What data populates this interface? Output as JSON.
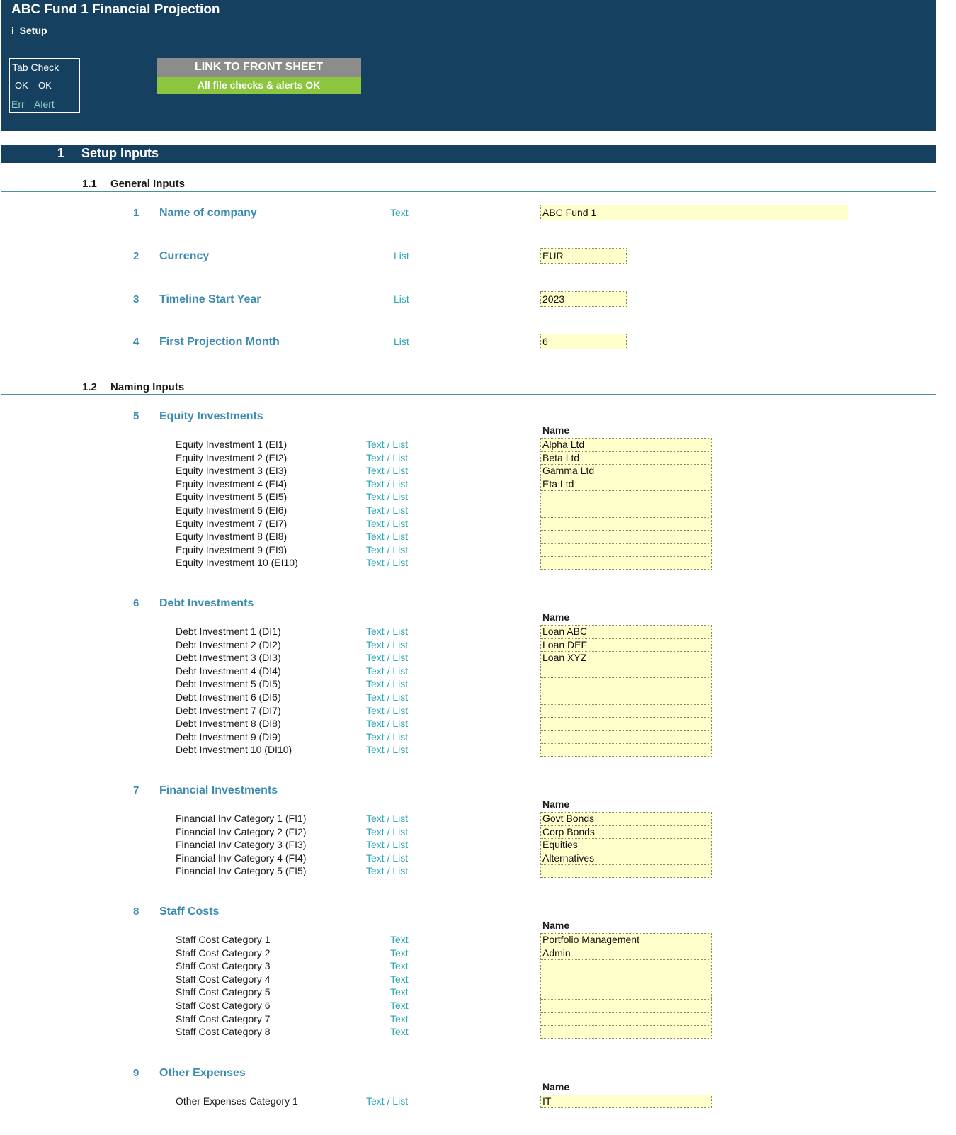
{
  "header": {
    "title": "ABC Fund 1 Financial Projection",
    "sheet_name": "i_Setup",
    "tab_check": {
      "title": "Tab Check",
      "ok_1": "OK",
      "ok_2": "OK",
      "err": "Err",
      "alert": "Alert"
    },
    "link_button": "LINK TO FRONT SHEET",
    "check_status": "All file checks & alerts OK"
  },
  "section": {
    "number": "1",
    "title": "Setup Inputs"
  },
  "general": {
    "number": "1.1",
    "title": "General Inputs",
    "items": [
      {
        "num": "1",
        "label": "Name of company",
        "type": "Text",
        "value": "ABC Fund 1"
      },
      {
        "num": "2",
        "label": "Currency",
        "type": "List",
        "value": "EUR"
      },
      {
        "num": "3",
        "label": "Timeline Start Year",
        "type": "List",
        "value": "2023"
      },
      {
        "num": "4",
        "label": "First Projection Month",
        "type": "List",
        "value": "6"
      }
    ]
  },
  "naming": {
    "number": "1.2",
    "title": "Naming Inputs",
    "name_header": "Name",
    "groups": [
      {
        "num": "5",
        "title": "Equity Investments",
        "rows": [
          {
            "label": "Equity Investment 1 (EI1)",
            "type": "Text / List",
            "value": "Alpha Ltd"
          },
          {
            "label": "Equity Investment 2 (EI2)",
            "type": "Text / List",
            "value": "Beta Ltd"
          },
          {
            "label": "Equity Investment 3 (EI3)",
            "type": "Text / List",
            "value": "Gamma Ltd"
          },
          {
            "label": "Equity Investment 4 (EI4)",
            "type": "Text / List",
            "value": "Eta Ltd"
          },
          {
            "label": "Equity Investment 5 (EI5)",
            "type": "Text / List",
            "value": ""
          },
          {
            "label": "Equity Investment 6 (EI6)",
            "type": "Text / List",
            "value": ""
          },
          {
            "label": "Equity Investment 7 (EI7)",
            "type": "Text / List",
            "value": ""
          },
          {
            "label": "Equity Investment 8 (EI8)",
            "type": "Text / List",
            "value": ""
          },
          {
            "label": "Equity Investment 9 (EI9)",
            "type": "Text / List",
            "value": ""
          },
          {
            "label": "Equity Investment 10 (EI10)",
            "type": "Text / List",
            "value": ""
          }
        ]
      },
      {
        "num": "6",
        "title": "Debt Investments",
        "rows": [
          {
            "label": "Debt Investment 1 (DI1)",
            "type": "Text / List",
            "value": "Loan ABC"
          },
          {
            "label": "Debt Investment 2 (DI2)",
            "type": "Text / List",
            "value": "Loan DEF"
          },
          {
            "label": "Debt Investment 3 (DI3)",
            "type": "Text / List",
            "value": "Loan XYZ"
          },
          {
            "label": "Debt Investment 4 (DI4)",
            "type": "Text / List",
            "value": ""
          },
          {
            "label": "Debt Investment 5 (DI5)",
            "type": "Text / List",
            "value": ""
          },
          {
            "label": "Debt Investment 6 (DI6)",
            "type": "Text / List",
            "value": ""
          },
          {
            "label": "Debt Investment 7 (DI7)",
            "type": "Text / List",
            "value": ""
          },
          {
            "label": "Debt Investment 8 (DI8)",
            "type": "Text / List",
            "value": ""
          },
          {
            "label": "Debt Investment 9 (DI9)",
            "type": "Text / List",
            "value": ""
          },
          {
            "label": "Debt Investment 10 (DI10)",
            "type": "Text / List",
            "value": ""
          }
        ]
      },
      {
        "num": "7",
        "title": "Financial Investments",
        "rows": [
          {
            "label": "Financial Inv Category 1 (FI1)",
            "type": "Text / List",
            "value": "Govt Bonds"
          },
          {
            "label": "Financial Inv Category 2 (FI2)",
            "type": "Text / List",
            "value": "Corp Bonds"
          },
          {
            "label": "Financial Inv Category 3 (FI3)",
            "type": "Text / List",
            "value": "Equities"
          },
          {
            "label": "Financial Inv Category 4 (FI4)",
            "type": "Text / List",
            "value": "Alternatives"
          },
          {
            "label": "Financial Inv Category 5 (FI5)",
            "type": "Text / List",
            "value": ""
          }
        ]
      },
      {
        "num": "8",
        "title": "Staff Costs",
        "rows": [
          {
            "label": "Staff Cost Category 1",
            "type": "Text",
            "value": "Portfolio Management"
          },
          {
            "label": "Staff Cost Category 2",
            "type": "Text",
            "value": "Admin"
          },
          {
            "label": "Staff Cost Category 3",
            "type": "Text",
            "value": ""
          },
          {
            "label": "Staff Cost Category 4",
            "type": "Text",
            "value": ""
          },
          {
            "label": "Staff Cost Category 5",
            "type": "Text",
            "value": ""
          },
          {
            "label": "Staff Cost Category 6",
            "type": "Text",
            "value": ""
          },
          {
            "label": "Staff Cost Category 7",
            "type": "Text",
            "value": ""
          },
          {
            "label": "Staff Cost Category 8",
            "type": "Text",
            "value": ""
          }
        ]
      },
      {
        "num": "9",
        "title": "Other Expenses",
        "rows": [
          {
            "label": "Other Expenses Category 1",
            "type": "Text / List",
            "value": "IT"
          }
        ]
      }
    ]
  }
}
